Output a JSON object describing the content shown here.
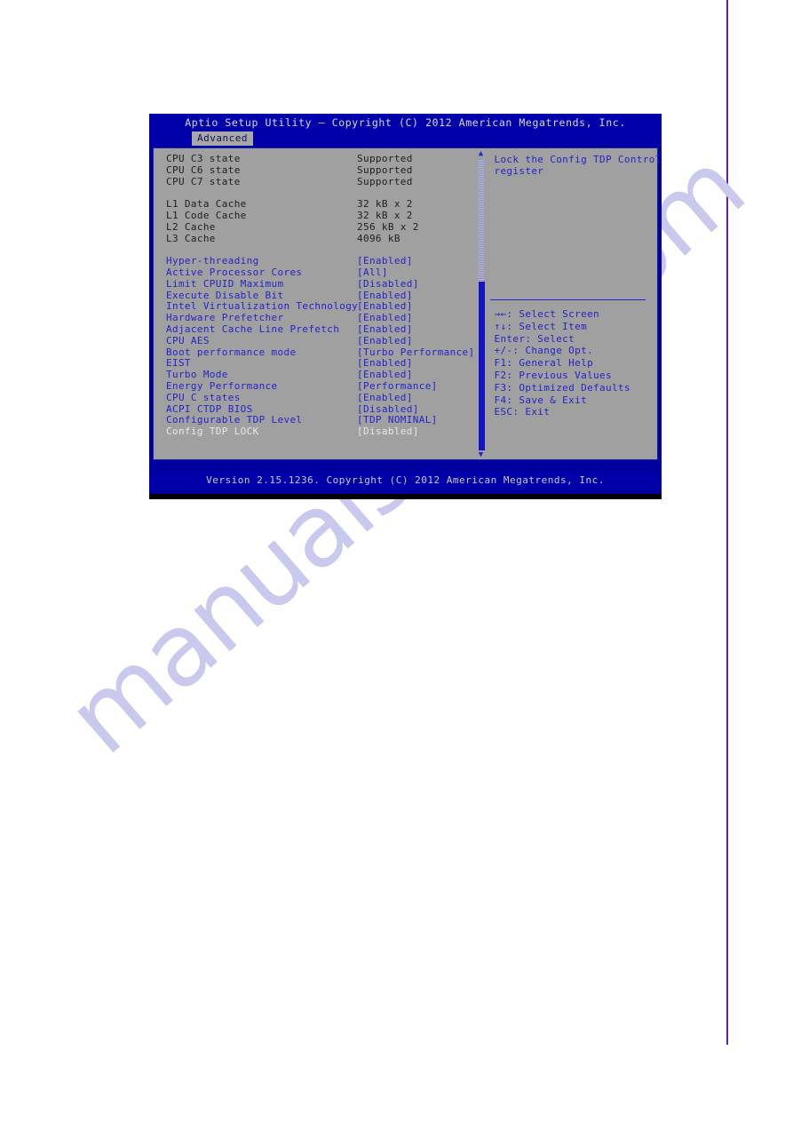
{
  "page": {
    "watermark": "manualshive.com"
  },
  "bios": {
    "title": "Aptio Setup Utility – Copyright (C) 2012 American Megatrends, Inc.",
    "active_tab": "Advanced",
    "footer": "Version 2.15.1236. Copyright (C) 2012 American Megatrends, Inc.",
    "settings": [
      {
        "type": "info",
        "label": "CPU C3 state",
        "value": "Supported"
      },
      {
        "type": "info",
        "label": "CPU C6 state",
        "value": "Supported"
      },
      {
        "type": "info",
        "label": "CPU C7 state",
        "value": "Supported"
      },
      {
        "type": "spacer",
        "label": "",
        "value": ""
      },
      {
        "type": "info",
        "label": "L1 Data Cache",
        "value": "32 kB x 2"
      },
      {
        "type": "info",
        "label": "L1 Code Cache",
        "value": "32 kB x 2"
      },
      {
        "type": "info",
        "label": "L2 Cache",
        "value": "256 kB x 2"
      },
      {
        "type": "info",
        "label": "L3 Cache",
        "value": "4096 kB"
      },
      {
        "type": "spacer",
        "label": "",
        "value": ""
      },
      {
        "type": "opt",
        "label": "Hyper-threading",
        "value": "[Enabled]"
      },
      {
        "type": "opt",
        "label": "Active Processor Cores",
        "value": "[All]"
      },
      {
        "type": "opt",
        "label": "Limit CPUID Maximum",
        "value": "[Disabled]"
      },
      {
        "type": "opt",
        "label": "Execute Disable Bit",
        "value": "[Enabled]"
      },
      {
        "type": "opt",
        "label": "Intel Virtualization Technology",
        "value": "[Enabled]"
      },
      {
        "type": "opt",
        "label": "Hardware Prefetcher",
        "value": "[Enabled]"
      },
      {
        "type": "opt",
        "label": "Adjacent Cache Line Prefetch",
        "value": "[Enabled]"
      },
      {
        "type": "opt",
        "label": "CPU AES",
        "value": "[Enabled]"
      },
      {
        "type": "opt",
        "label": "Boot performance mode",
        "value": "[Turbo Performance]"
      },
      {
        "type": "opt",
        "label": "EIST",
        "value": "[Enabled]"
      },
      {
        "type": "opt",
        "label": "Turbo Mode",
        "value": "[Enabled]"
      },
      {
        "type": "opt",
        "label": "Energy Performance",
        "value": "[Performance]"
      },
      {
        "type": "opt",
        "label": "CPU C states",
        "value": "[Enabled]"
      },
      {
        "type": "opt",
        "label": "ACPI CTDP BIOS",
        "value": "[Disabled]"
      },
      {
        "type": "opt",
        "label": "Configurable TDP Level",
        "value": "[TDP NOMINAL]"
      },
      {
        "type": "selected",
        "label": "Config TDP LOCK",
        "value": "[Disabled]"
      }
    ],
    "scrollbar": {
      "up_arrow": "▲",
      "down_arrow": "▼",
      "thumb_top_pct": 42,
      "thumb_height_pct": 58
    },
    "help": {
      "lines": [
        "Lock the Config TDP Control",
        "register"
      ]
    },
    "keys": [
      "→←: Select Screen",
      "↑↓: Select Item",
      "Enter: Select",
      "+/-: Change Opt.",
      "F1: General Help",
      "F2: Previous Values",
      "F3: Optimized Defaults",
      "F4: Save & Exit",
      "ESC: Exit"
    ]
  }
}
